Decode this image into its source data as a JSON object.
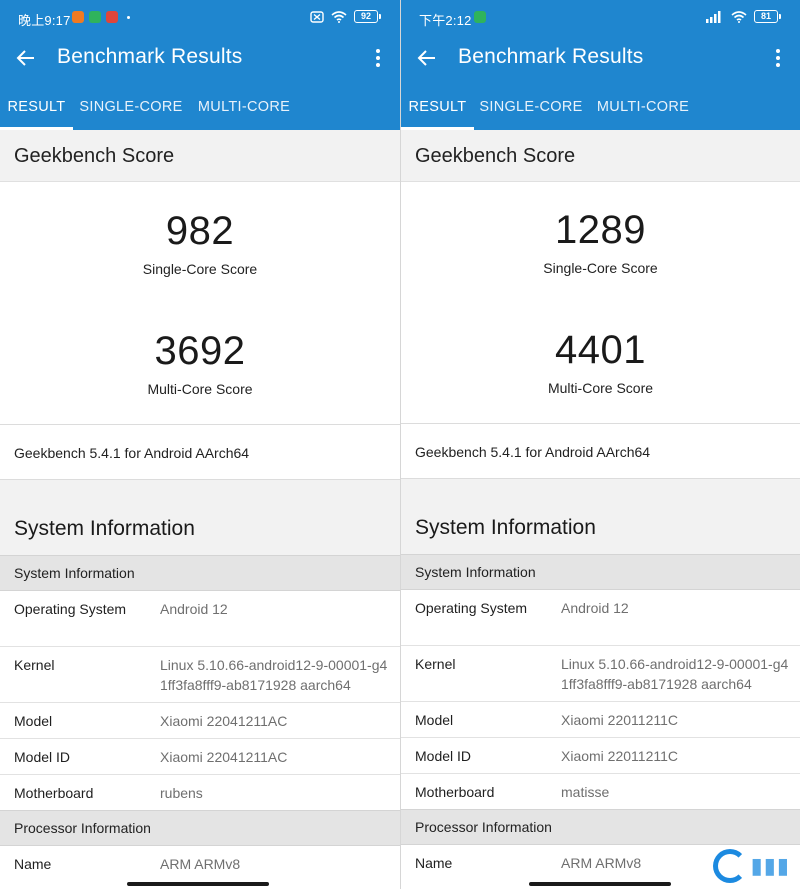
{
  "colors": {
    "appbar": "#1f86cf",
    "section_bg": "#f2f2f2",
    "subhead_bg": "#e4e4e4",
    "value_gray": "#6f6f6f"
  },
  "left": {
    "status": {
      "time": "晚上9:17",
      "battery": "92"
    },
    "toolbar": {
      "title": "Benchmark Results",
      "back_icon": "arrow-left-icon",
      "more_icon": "more-vert-icon"
    },
    "tabs": [
      {
        "label": "RESULT"
      },
      {
        "label": "SINGLE-CORE"
      },
      {
        "label": "MULTI-CORE"
      }
    ],
    "geekbench_title": "Geekbench Score",
    "single_score": "982",
    "single_label": "Single-Core Score",
    "multi_score": "3692",
    "multi_label": "Multi-Core Score",
    "version": "Geekbench 5.4.1 for Android AArch64",
    "sysinfo_title": "System Information",
    "sys_subhead": "System Information",
    "rows": [
      {
        "key": "Operating System",
        "value": "Android 12"
      },
      {
        "key": "Kernel",
        "value": "Linux 5.10.66-android12-9-00001-g41ff3fa8fff9-ab8171928 aarch64"
      },
      {
        "key": "Model",
        "value": "Xiaomi 22041211AC"
      },
      {
        "key": "Model ID",
        "value": "Xiaomi 22041211AC"
      },
      {
        "key": "Motherboard",
        "value": "rubens"
      }
    ],
    "proc_subhead": "Processor Information",
    "proc_rows": [
      {
        "key": "Name",
        "value": "ARM ARMv8"
      }
    ]
  },
  "right": {
    "status": {
      "time": "下午2:12",
      "battery": "81"
    },
    "toolbar": {
      "title": "Benchmark Results",
      "back_icon": "arrow-left-icon",
      "more_icon": "more-vert-icon"
    },
    "tabs": [
      {
        "label": "RESULT"
      },
      {
        "label": "SINGLE-CORE"
      },
      {
        "label": "MULTI-CORE"
      }
    ],
    "geekbench_title": "Geekbench Score",
    "single_score": "1289",
    "single_label": "Single-Core Score",
    "multi_score": "4401",
    "multi_label": "Multi-Core Score",
    "version": "Geekbench 5.4.1 for Android AArch64",
    "sysinfo_title": "System Information",
    "sys_subhead": "System Information",
    "rows": [
      {
        "key": "Operating System",
        "value": "Android 12"
      },
      {
        "key": "Kernel",
        "value": "Linux 5.10.66-android12-9-00001-g41ff3fa8fff9-ab8171928 aarch64"
      },
      {
        "key": "Model",
        "value": "Xiaomi 22011211C"
      },
      {
        "key": "Model ID",
        "value": "Xiaomi 22011211C"
      },
      {
        "key": "Motherboard",
        "value": "matisse"
      }
    ],
    "proc_subhead": "Processor Information",
    "proc_rows": [
      {
        "key": "Name",
        "value": "ARM ARMv8"
      }
    ]
  }
}
